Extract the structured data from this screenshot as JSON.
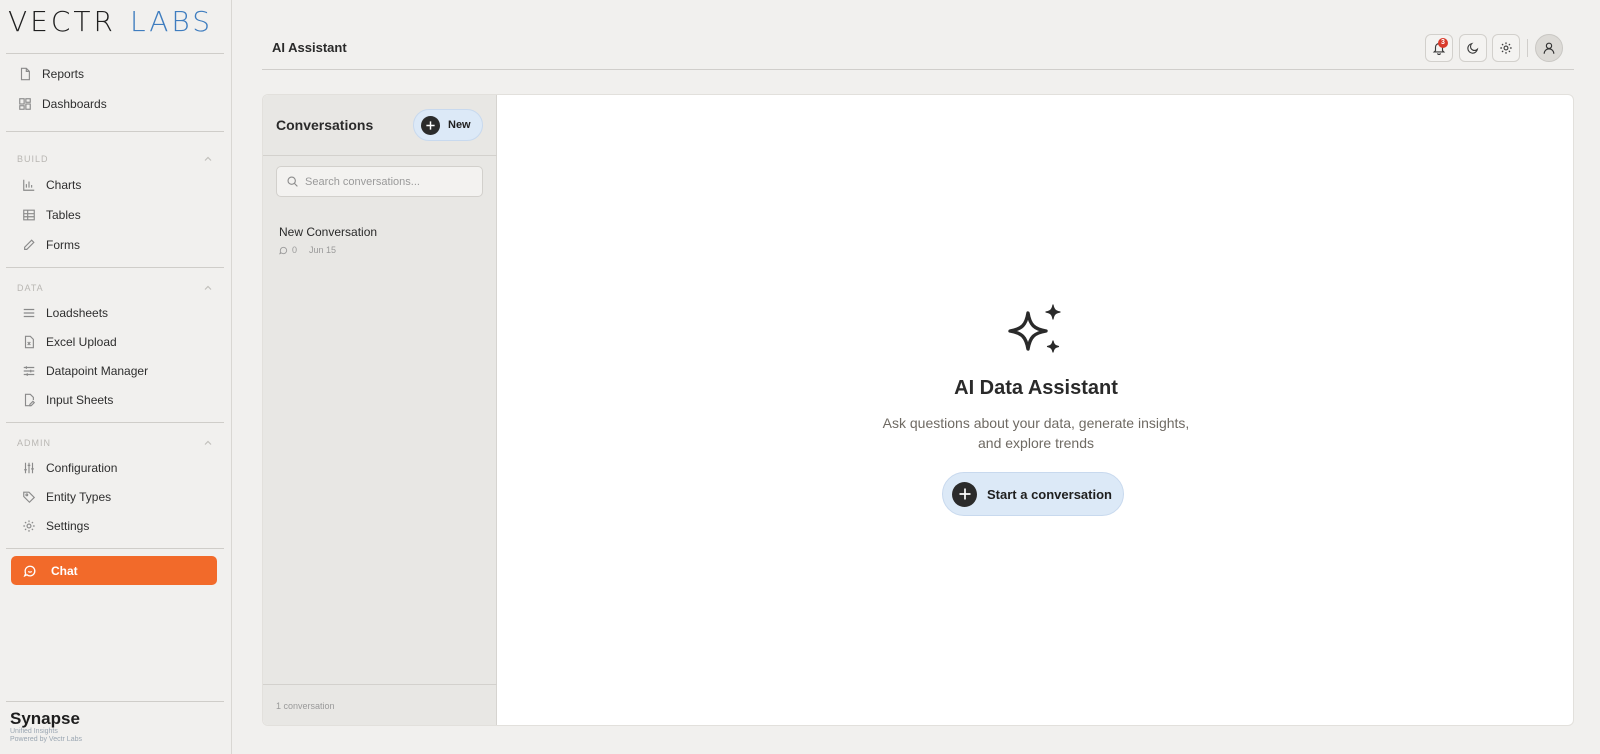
{
  "logo": {
    "word1": "VECTR",
    "word2": "LABS"
  },
  "sidebar": {
    "top_items": [
      {
        "label": "Reports",
        "icon": "file-icon"
      },
      {
        "label": "Dashboards",
        "icon": "grid-icon"
      }
    ],
    "sections": [
      {
        "title": "BUILD",
        "items": [
          {
            "label": "Charts",
            "icon": "bar-chart-icon"
          },
          {
            "label": "Tables",
            "icon": "table-icon"
          },
          {
            "label": "Forms",
            "icon": "pencil-icon"
          }
        ]
      },
      {
        "title": "DATA",
        "items": [
          {
            "label": "Loadsheets",
            "icon": "list-icon"
          },
          {
            "label": "Excel Upload",
            "icon": "spreadsheet-file-icon"
          },
          {
            "label": "Datapoint Manager",
            "icon": "sliders-icon"
          },
          {
            "label": "Input Sheets",
            "icon": "file-edit-icon"
          }
        ]
      },
      {
        "title": "ADMIN",
        "items": [
          {
            "label": "Configuration",
            "icon": "vertical-sliders-icon"
          },
          {
            "label": "Entity Types",
            "icon": "tag-icon"
          },
          {
            "label": "Settings",
            "icon": "gear-icon"
          }
        ]
      }
    ],
    "active_item": {
      "label": "Chat",
      "icon": "chat-icon",
      "color": "#f26a2a"
    },
    "brand": {
      "name": "Synapse",
      "tagline": "Unified Insights",
      "powered_by": "Powered by Vectr Labs"
    }
  },
  "header": {
    "title": "AI Assistant",
    "notification_count": "3",
    "icons": [
      "bell-icon",
      "moon-icon",
      "gear-icon",
      "user-icon"
    ]
  },
  "conversations": {
    "title": "Conversations",
    "new_label": "New",
    "search_placeholder": "Search conversations...",
    "items": [
      {
        "title": "New Conversation",
        "message_count": "0",
        "date": "Jun 15"
      }
    ],
    "footer": "1 conversation"
  },
  "empty_state": {
    "title": "AI Data Assistant",
    "description_line1": "Ask questions about your data, generate insights,",
    "description_line2": "and explore trends",
    "button_label": "Start a conversation",
    "accent_color": "#dce9f7"
  }
}
